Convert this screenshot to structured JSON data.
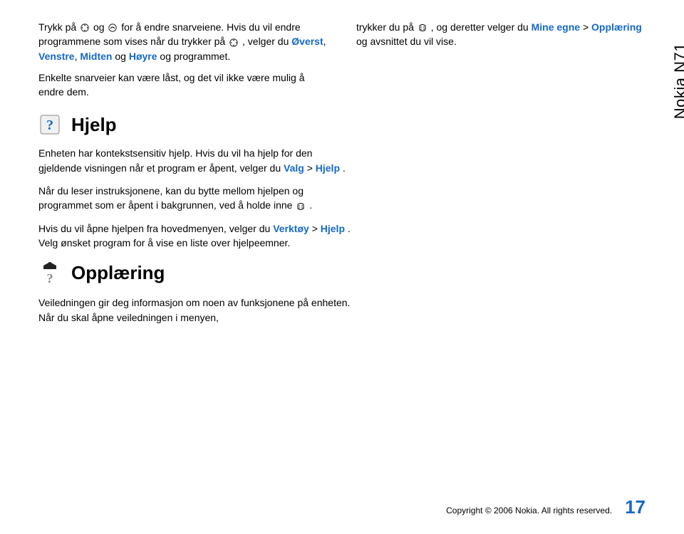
{
  "side_label": "Nokia N71",
  "top_left": {
    "p1_a": "Trykk på ",
    "p1_b": " og ",
    "p1_c": " for å endre snarveiene. Hvis du vil endre programmene som vises når du trykker på ",
    "p1_d": ", velger du ",
    "p1_links": [
      "Øverst",
      "Venstre",
      "Midten",
      "Høyre"
    ],
    "p1_e": " og programmet.",
    "p2": "Enkelte snarveier kan være låst, og det vil ikke være mulig å endre dem."
  },
  "top_right": {
    "p1_a": "trykker du på ",
    "p1_b": ", og deretter velger du ",
    "p1_link1": "Mine egne",
    "p1_c": " > ",
    "p1_link2": "Opplæring",
    "p1_d": " og avsnittet du vil vise."
  },
  "help": {
    "title": "Hjelp",
    "p1_a": "Enheten har kontekstsensitiv hjelp. Hvis du vil ha hjelp for den gjeldende visningen når et program er åpent, velger du ",
    "p1_link": "Valg",
    "p1_b": " > ",
    "p1_link2": "Hjelp",
    "p1_c": ".",
    "p2_a": "Når du leser instruksjonene, kan du bytte mellom hjelpen og programmet som er åpent i bakgrunnen, ved å holde inne ",
    "p2_b": ".",
    "p3_a": "Hvis du vil åpne hjelpen fra hovedmenyen, velger du ",
    "p3_link": "Verktøy",
    "p3_b": " > ",
    "p3_link2": "Hjelp",
    "p3_c": ". Velg ønsket program for å vise en liste over hjelpeemner."
  },
  "tutorial": {
    "title": "Opplæring",
    "p1": "Veiledningen gir deg informasjon om noen av funksjonene på enheten. Når du skal åpne veiledningen i menyen,"
  },
  "footer": {
    "copyright": "Copyright © 2006 Nokia. All rights reserved.",
    "page": "17"
  }
}
